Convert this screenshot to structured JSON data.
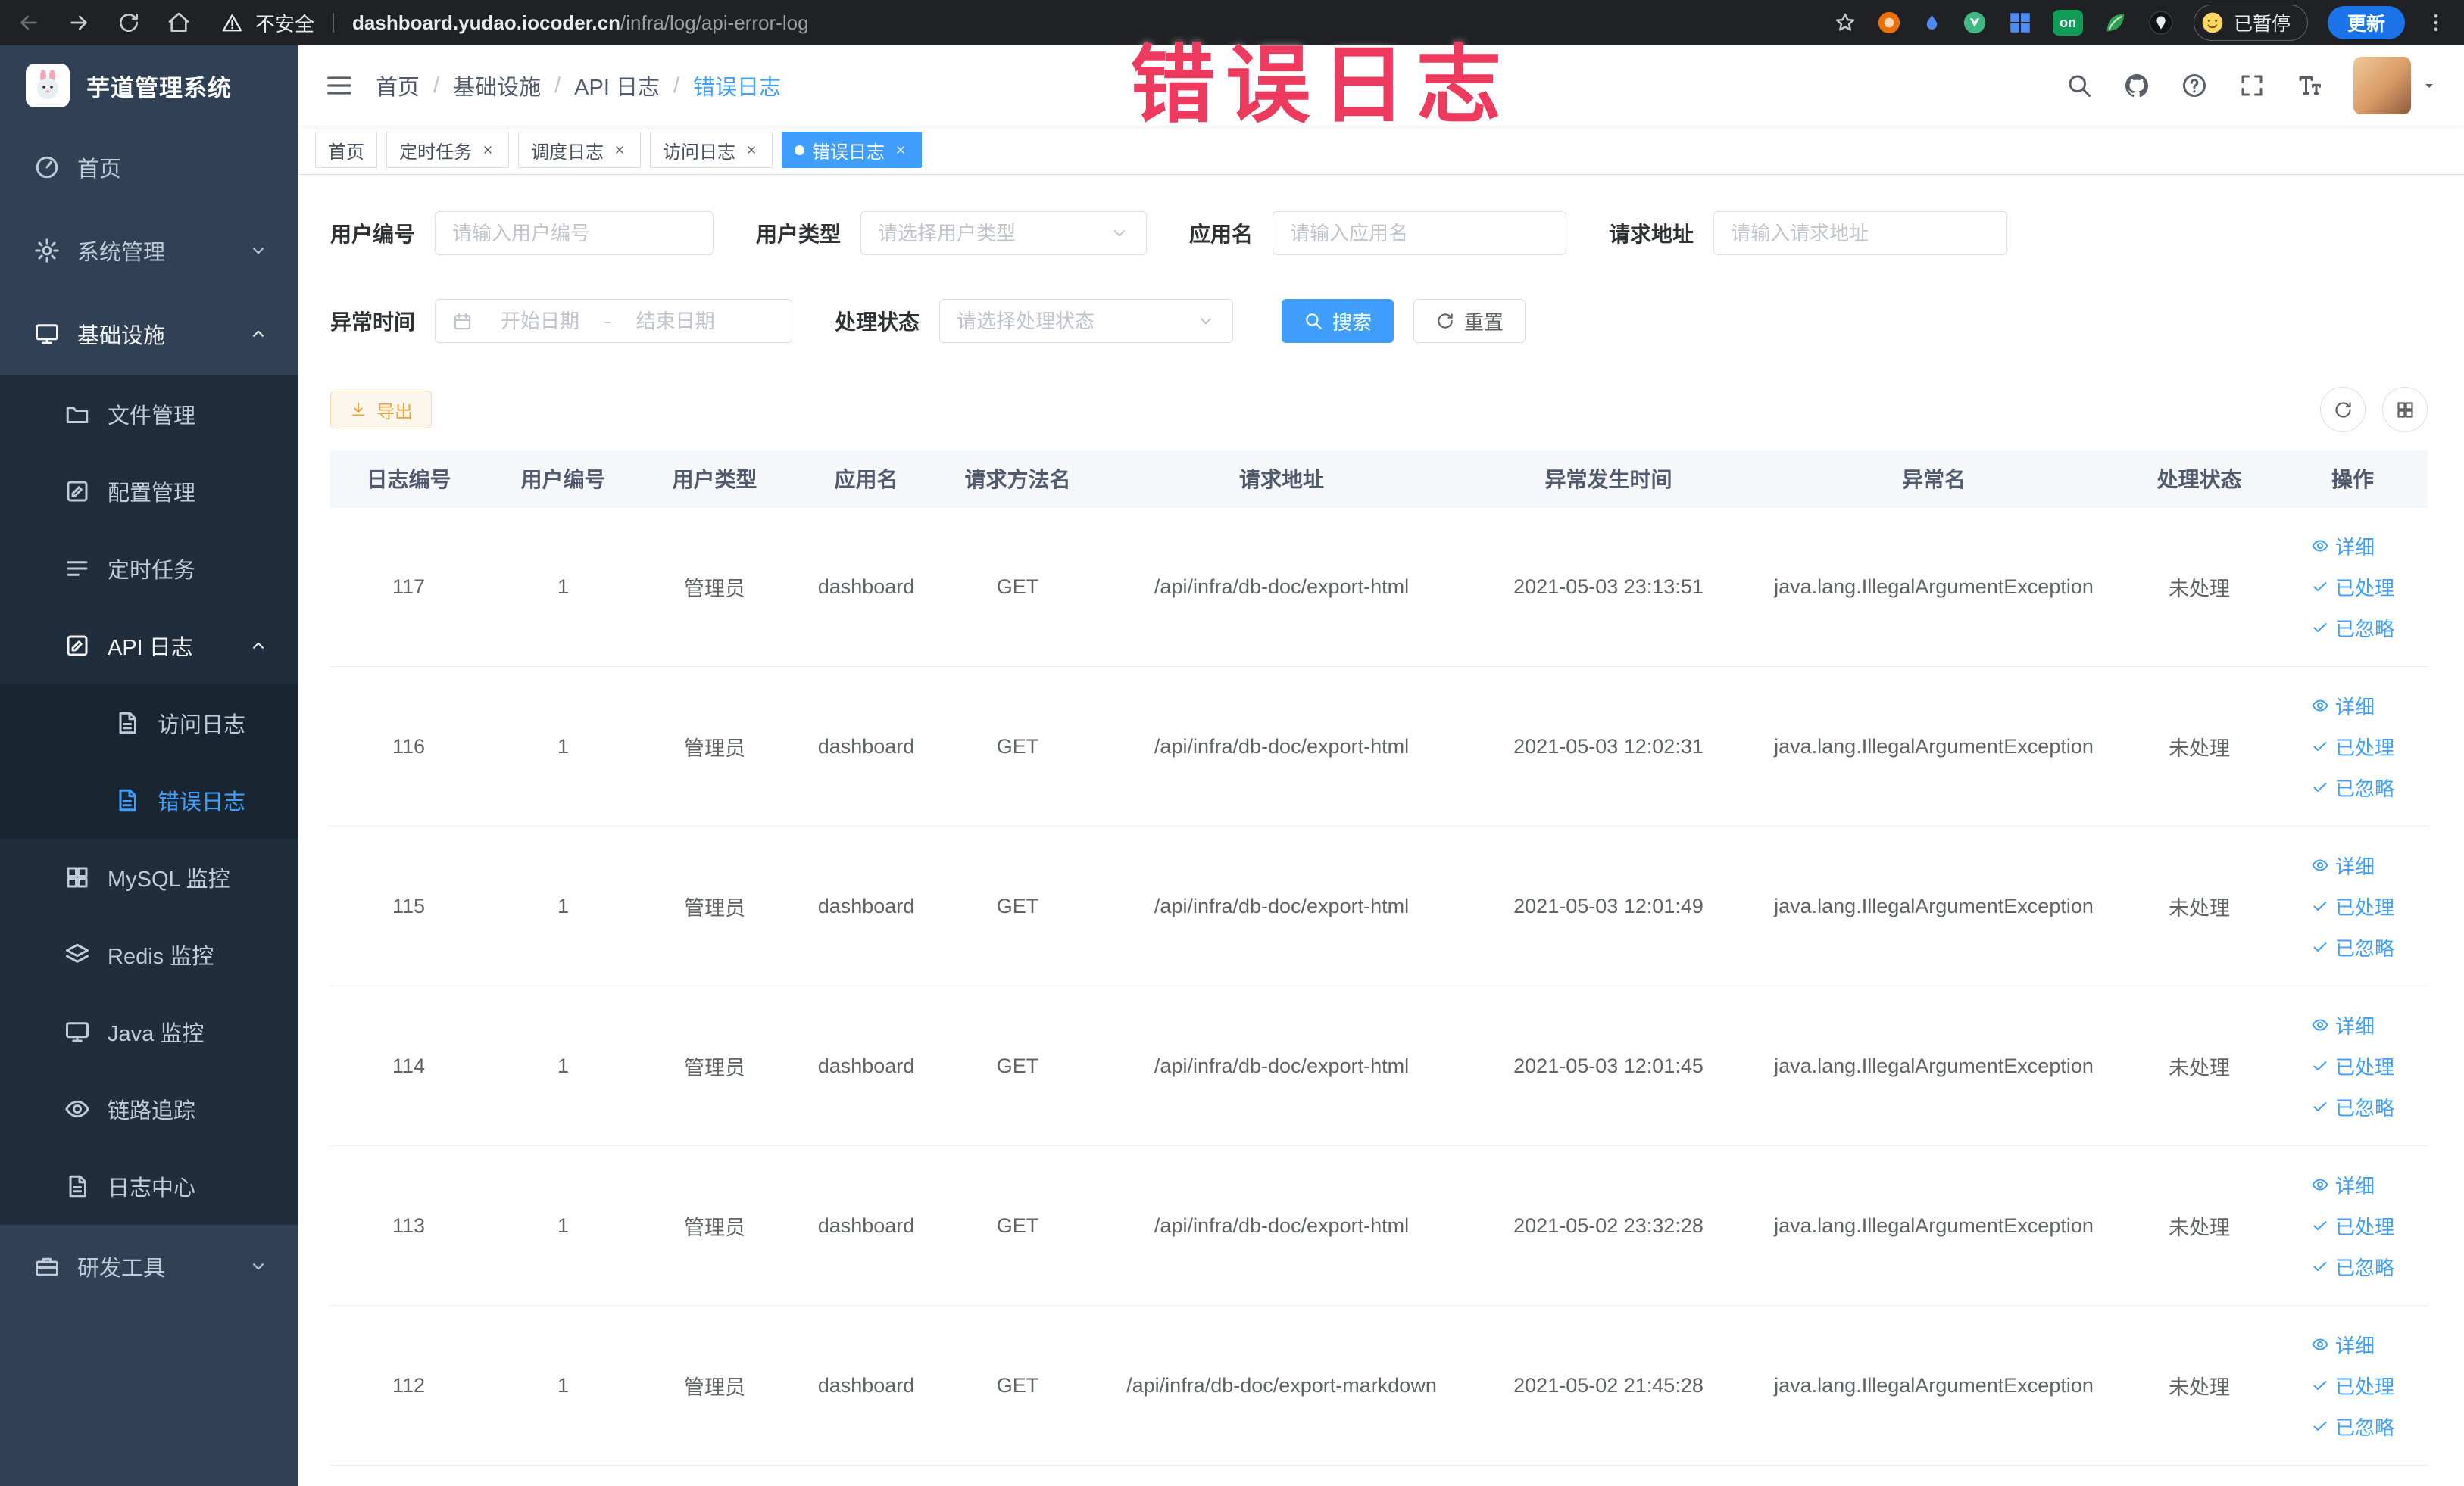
{
  "colors": {
    "accent": "#409eff",
    "annotation_red": "#ee3a5e",
    "warning": "#e6a23c",
    "sidebar_bg": "#304156",
    "submenu_bg": "#1f2d3d"
  },
  "annotation": {
    "text": "错误日志"
  },
  "browser": {
    "security_label": "不安全",
    "url_domain": "dashboard.yudao.iocoder.cn",
    "url_path": "/infra/log/api-error-log",
    "extension_on_badge": "on",
    "profile_chip": "已暂停",
    "update_button": "更新"
  },
  "sidebar": {
    "title": "芋道管理系统",
    "items": [
      {
        "name": "home",
        "label": "首页",
        "icon": "dashboard-icon",
        "level": 1
      },
      {
        "name": "system-management",
        "label": "系统管理",
        "icon": "gear-icon",
        "level": 1,
        "arrow": "down"
      },
      {
        "name": "infrastructure",
        "label": "基础设施",
        "icon": "monitor-icon",
        "level": 1,
        "arrow": "up",
        "expanded": true
      },
      {
        "name": "file-management",
        "label": "文件管理",
        "icon": "folder-icon",
        "level": 2
      },
      {
        "name": "config-management",
        "label": "配置管理",
        "icon": "edit-icon",
        "level": 2
      },
      {
        "name": "scheduled-tasks",
        "label": "定时任务",
        "icon": "list-icon",
        "level": 2
      },
      {
        "name": "api-log",
        "label": "API 日志",
        "icon": "edit-icon",
        "level": 2,
        "arrow": "up",
        "expanded": true
      },
      {
        "name": "access-log",
        "label": "访问日志",
        "icon": "document-icon",
        "level": 3
      },
      {
        "name": "error-log",
        "label": "错误日志",
        "icon": "document-icon",
        "level": 3,
        "active": true
      },
      {
        "name": "mysql-monitor",
        "label": "MySQL 监控",
        "icon": "grid-icon",
        "level": 2
      },
      {
        "name": "redis-monitor",
        "label": "Redis 监控",
        "icon": "layers-icon",
        "level": 2
      },
      {
        "name": "java-monitor",
        "label": "Java 监控",
        "icon": "monitor-icon",
        "level": 2
      },
      {
        "name": "link-tracing",
        "label": "链路追踪",
        "icon": "eye-icon",
        "level": 2
      },
      {
        "name": "log-center",
        "label": "日志中心",
        "icon": "document-icon",
        "level": 2
      },
      {
        "name": "dev-tools",
        "label": "研发工具",
        "icon": "toolbox-icon",
        "level": 1,
        "arrow": "down"
      }
    ]
  },
  "header": {
    "breadcrumb": [
      "首页",
      "基础设施",
      "API 日志",
      "错误日志"
    ]
  },
  "tabs": [
    {
      "name": "home",
      "label": "首页",
      "closable": false,
      "active": false
    },
    {
      "name": "scheduled-tasks",
      "label": "定时任务",
      "closable": true,
      "active": false
    },
    {
      "name": "schedule-log",
      "label": "调度日志",
      "closable": true,
      "active": false
    },
    {
      "name": "access-log",
      "label": "访问日志",
      "closable": true,
      "active": false
    },
    {
      "name": "error-log",
      "label": "错误日志",
      "closable": true,
      "active": true
    }
  ],
  "filters": {
    "user_id": {
      "label": "用户编号",
      "placeholder": "请输入用户编号"
    },
    "user_type": {
      "label": "用户类型",
      "placeholder": "请选择用户类型"
    },
    "app_name": {
      "label": "应用名",
      "placeholder": "请输入应用名"
    },
    "request_url": {
      "label": "请求地址",
      "placeholder": "请输入请求地址"
    },
    "exception_time": {
      "label": "异常时间",
      "start_placeholder": "开始日期",
      "separator": "-",
      "end_placeholder": "结束日期"
    },
    "process_status": {
      "label": "处理状态",
      "placeholder": "请选择处理状态"
    },
    "search_button": "搜索",
    "reset_button": "重置"
  },
  "toolbar": {
    "export_button": "导出"
  },
  "table": {
    "columns": [
      "日志编号",
      "用户编号",
      "用户类型",
      "应用名",
      "请求方法名",
      "请求地址",
      "异常发生时间",
      "异常名",
      "处理状态",
      "操作"
    ],
    "actions": [
      "详细",
      "已处理",
      "已忽略"
    ],
    "rows": [
      {
        "id": "117",
        "user_id": "1",
        "user_type": "管理员",
        "app": "dashboard",
        "method": "GET",
        "url": "/api/infra/db-doc/export-html",
        "time": "2021-05-03 23:13:51",
        "exception": "java.lang.IllegalArgumentException",
        "status": "未处理"
      },
      {
        "id": "116",
        "user_id": "1",
        "user_type": "管理员",
        "app": "dashboard",
        "method": "GET",
        "url": "/api/infra/db-doc/export-html",
        "time": "2021-05-03 12:02:31",
        "exception": "java.lang.IllegalArgumentException",
        "status": "未处理"
      },
      {
        "id": "115",
        "user_id": "1",
        "user_type": "管理员",
        "app": "dashboard",
        "method": "GET",
        "url": "/api/infra/db-doc/export-html",
        "time": "2021-05-03 12:01:49",
        "exception": "java.lang.IllegalArgumentException",
        "status": "未处理"
      },
      {
        "id": "114",
        "user_id": "1",
        "user_type": "管理员",
        "app": "dashboard",
        "method": "GET",
        "url": "/api/infra/db-doc/export-html",
        "time": "2021-05-03 12:01:45",
        "exception": "java.lang.IllegalArgumentException",
        "status": "未处理"
      },
      {
        "id": "113",
        "user_id": "1",
        "user_type": "管理员",
        "app": "dashboard",
        "method": "GET",
        "url": "/api/infra/db-doc/export-html",
        "time": "2021-05-02 23:32:28",
        "exception": "java.lang.IllegalArgumentException",
        "status": "未处理"
      },
      {
        "id": "112",
        "user_id": "1",
        "user_type": "管理员",
        "app": "dashboard",
        "method": "GET",
        "url": "/api/infra/db-doc/export-markdown",
        "time": "2021-05-02 21:45:28",
        "exception": "java.lang.IllegalArgumentException",
        "status": "未处理"
      }
    ]
  }
}
